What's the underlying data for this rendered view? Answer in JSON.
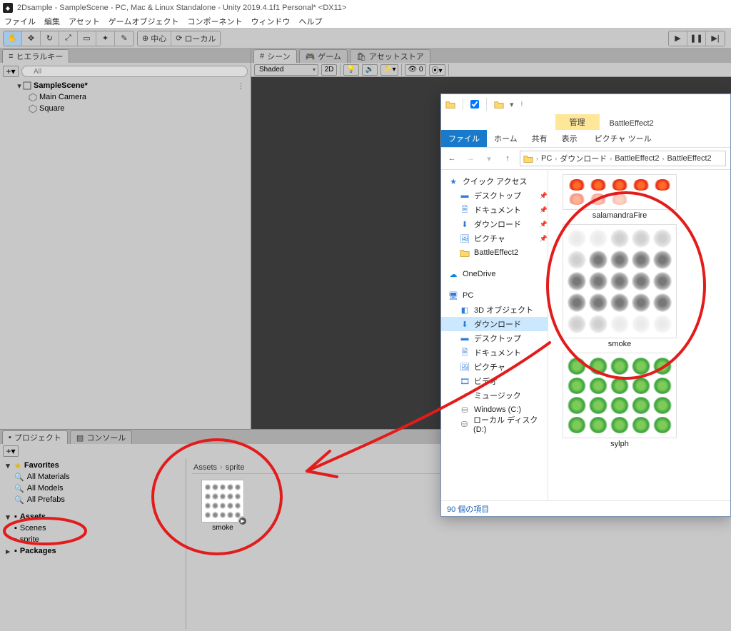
{
  "window": {
    "title": "2Dsample - SampleScene - PC, Mac & Linux Standalone - Unity 2019.4.1f1 Personal* <DX11>"
  },
  "menu": [
    "ファイル",
    "編集",
    "アセット",
    "ゲームオブジェクト",
    "コンポーネント",
    "ウィンドウ",
    "ヘルプ"
  ],
  "toolbar": {
    "center": "中心",
    "local": "ローカル",
    "play": "▶",
    "pause": "❚❚",
    "step": "▶|"
  },
  "hierarchy": {
    "tab": "ヒエラルキー",
    "search_placeholder": "All",
    "scene": "SampleScene*",
    "items": [
      "Main Camera",
      "Square"
    ]
  },
  "sceneView": {
    "tabs": [
      "シーン",
      "ゲーム",
      "アセットストア"
    ],
    "shading": "Shaded",
    "btn2d": "2D"
  },
  "project": {
    "tabs": [
      "プロジェクト",
      "コンソール"
    ],
    "favorites": "Favorites",
    "fav_items": [
      "All Materials",
      "All Models",
      "All Prefabs"
    ],
    "assets": "Assets",
    "folders": [
      "Scenes",
      "sprite",
      "Packages"
    ],
    "breadcrumb": [
      "Assets",
      "sprite"
    ],
    "asset_name": "smoke"
  },
  "explorer": {
    "manage": "管理",
    "title": "BattleEffect2",
    "menu": [
      "ファイル",
      "ホーム",
      "共有",
      "表示"
    ],
    "tool": "ピクチャ ツール",
    "path": [
      "PC",
      "ダウンロード",
      "BattleEffect2",
      "BattleEffect2"
    ],
    "quick": "クイック アクセス",
    "quick_items": [
      "デスクトップ",
      "ドキュメント",
      "ダウンロード",
      "ピクチャ",
      "BattleEffect2"
    ],
    "onedrive": "OneDrive",
    "pc": "PC",
    "pc_items": [
      "3D オブジェクト",
      "ダウンロード",
      "デスクトップ",
      "ドキュメント",
      "ピクチャ",
      "ビデオ",
      "ミュージック",
      "Windows (C:)",
      "ローカル ディスク (D:)"
    ],
    "files": [
      "salamandraFire",
      "smoke",
      "sylph"
    ],
    "status": "90 個の項目"
  }
}
